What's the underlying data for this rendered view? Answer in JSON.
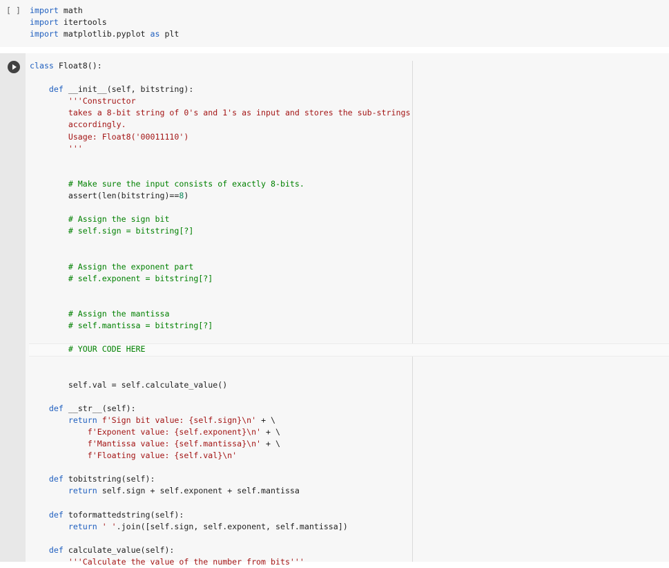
{
  "cells": [
    {
      "bracket": "[ ]",
      "lines": [
        [
          {
            "t": "import",
            "c": "kw"
          },
          {
            "t": " math",
            "c": ""
          }
        ],
        [
          {
            "t": "import",
            "c": "kw"
          },
          {
            "t": " itertools",
            "c": ""
          }
        ],
        [
          {
            "t": "import",
            "c": "kw"
          },
          {
            "t": " matplotlib.pyplot ",
            "c": ""
          },
          {
            "t": "as",
            "c": "kw"
          },
          {
            "t": " plt",
            "c": ""
          }
        ]
      ]
    },
    {
      "run_button": "play-icon",
      "lines": [
        [
          {
            "t": "class",
            "c": "kw"
          },
          {
            "t": " Float8():",
            "c": ""
          }
        ],
        [],
        [
          {
            "t": "    def",
            "c": "kw"
          },
          {
            "t": " __init__(self, bitstring):",
            "c": ""
          }
        ],
        [
          {
            "t": "        '''Constructor",
            "c": "str"
          }
        ],
        [
          {
            "t": "        takes a 8-bit string of 0's and 1's as input and stores the sub-strings",
            "c": "str"
          }
        ],
        [
          {
            "t": "        accordingly.",
            "c": "str"
          }
        ],
        [
          {
            "t": "        Usage: Float8('00011110')",
            "c": "str"
          }
        ],
        [
          {
            "t": "        '''",
            "c": "str"
          }
        ],
        [],
        [],
        [
          {
            "t": "        # Make sure the input consists of exactly 8-bits.",
            "c": "cm"
          }
        ],
        [
          {
            "t": "        assert(len(bitstring)==",
            "c": ""
          },
          {
            "t": "8",
            "c": "num"
          },
          {
            "t": ")",
            "c": ""
          }
        ],
        [],
        [
          {
            "t": "        # Assign the sign bit",
            "c": "cm"
          }
        ],
        [
          {
            "t": "        # self.sign = bitstring[?]",
            "c": "cm"
          }
        ],
        [],
        [],
        [
          {
            "t": "        # Assign the exponent part",
            "c": "cm"
          }
        ],
        [
          {
            "t": "        # self.exponent = bitstring[?]",
            "c": "cm"
          }
        ],
        [],
        [],
        [
          {
            "t": "        # Assign the mantissa",
            "c": "cm"
          }
        ],
        [
          {
            "t": "        # self.mantissa = bitstring[?]",
            "c": "cm"
          }
        ],
        [],
        [
          {
            "t": "        # YOUR CODE HERE",
            "c": "cm"
          }
        ],
        [],
        [],
        [
          {
            "t": "        self.val = self.calculate_value()",
            "c": ""
          }
        ],
        [],
        [
          {
            "t": "    def",
            "c": "kw"
          },
          {
            "t": " __str__(self):",
            "c": ""
          }
        ],
        [
          {
            "t": "        return",
            "c": "kw"
          },
          {
            "t": " ",
            "c": ""
          },
          {
            "t": "f'Sign bit value: {self.sign}\\n'",
            "c": "str"
          },
          {
            "t": " + \\",
            "c": ""
          }
        ],
        [
          {
            "t": "            f'Exponent value: {self.exponent}\\n'",
            "c": "str"
          },
          {
            "t": " + \\",
            "c": ""
          }
        ],
        [
          {
            "t": "            f'Mantissa value: {self.mantissa}\\n'",
            "c": "str"
          },
          {
            "t": " + \\",
            "c": ""
          }
        ],
        [
          {
            "t": "            f'Floating value: {self.val}\\n'",
            "c": "str"
          }
        ],
        [],
        [
          {
            "t": "    def",
            "c": "kw"
          },
          {
            "t": " tobitstring(self):",
            "c": ""
          }
        ],
        [
          {
            "t": "        return",
            "c": "kw"
          },
          {
            "t": " self.sign + self.exponent + self.mantissa",
            "c": ""
          }
        ],
        [],
        [
          {
            "t": "    def",
            "c": "kw"
          },
          {
            "t": " toformattedstring(self):",
            "c": ""
          }
        ],
        [
          {
            "t": "        return",
            "c": "kw"
          },
          {
            "t": " ",
            "c": ""
          },
          {
            "t": "' '",
            "c": "str"
          },
          {
            "t": ".join([self.sign, self.exponent, self.mantissa])",
            "c": ""
          }
        ],
        [],
        [
          {
            "t": "    def",
            "c": "kw"
          },
          {
            "t": " calculate_value(self):",
            "c": ""
          }
        ],
        [
          {
            "t": "        '''Calculate the value of the number from bits'''",
            "c": "str"
          }
        ]
      ]
    }
  ],
  "colors": {
    "keyword": "#1f5fbf",
    "string": "#a31515",
    "comment": "#008000",
    "number": "#098658"
  }
}
